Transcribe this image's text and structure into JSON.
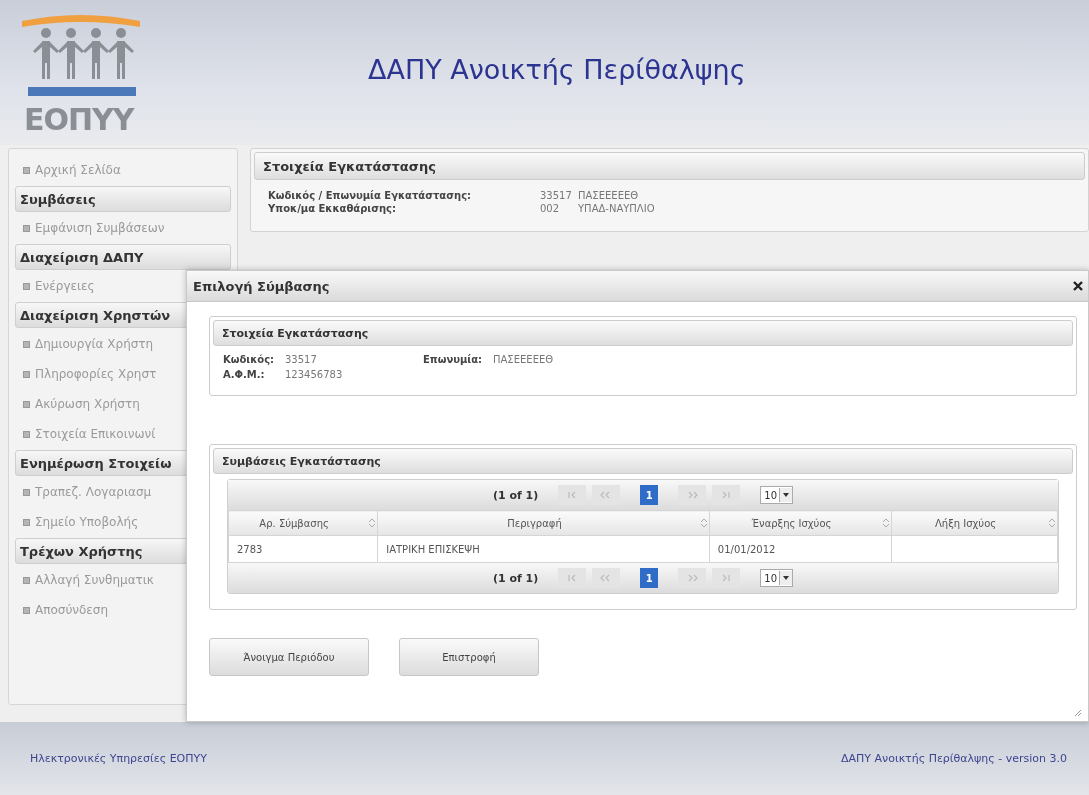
{
  "header": {
    "logo_text": "ΕΟΠΥΥ",
    "title": "ΔΑΠΥ Ανοικτής Περίθαλψης"
  },
  "sidebar": {
    "items": [
      {
        "kind": "link",
        "label": "Αρχική Σελίδα"
      },
      {
        "kind": "section",
        "label": "Συμβάσεις"
      },
      {
        "kind": "link",
        "label": "Εμφάνιση Συμβάσεων"
      },
      {
        "kind": "section",
        "label": "Διαχείριση ΔΑΠΥ"
      },
      {
        "kind": "link",
        "label": "Ενέργειες"
      },
      {
        "kind": "section",
        "label": "Διαχείριση Χρηστών"
      },
      {
        "kind": "link",
        "label": "Δημιουργία Χρήστη"
      },
      {
        "kind": "link",
        "label": "Πληροφορίες Χρηστ"
      },
      {
        "kind": "link",
        "label": "Ακύρωση Χρήστη"
      },
      {
        "kind": "link",
        "label": "Στοιχεία Επικοινωνί"
      },
      {
        "kind": "section",
        "label": "Ενημέρωση Στοιχείω"
      },
      {
        "kind": "link",
        "label": "Τραπεζ. Λογαριασμ"
      },
      {
        "kind": "link",
        "label": "Σημείο Υποβολής"
      },
      {
        "kind": "section",
        "label": "Τρέχων Χρήστης"
      },
      {
        "kind": "link",
        "label": "Αλλαγή Συνθηματικ"
      },
      {
        "kind": "link",
        "label": "Αποσύνδεση"
      }
    ]
  },
  "facility_panel": {
    "title": "Στοιχεία Εγκατάστασης",
    "rows": [
      {
        "label": "Κωδικός / Επωνυμία Εγκατάστασης:",
        "code": "33517",
        "name": "ΠΑΣΕΕΕΕΕΘ"
      },
      {
        "label": "Υποκ/μα Εκκαθάρισης:",
        "code": "002",
        "name": "ΥΠΑΔ-ΝΑΥΠΛΙΟ"
      }
    ]
  },
  "dialog": {
    "title": "Επιλογή Σύμβασης",
    "details": {
      "title": "Στοιχεία Εγκατάστασης",
      "fields": [
        {
          "label": "Κωδικός:",
          "value": "33517"
        },
        {
          "label": "Επωνυμία:",
          "value": "ΠΑΣΕΕΕΕΕΘ"
        },
        {
          "label": "Α.Φ.Μ.:",
          "value": "123456783"
        }
      ]
    },
    "contracts": {
      "title": "Συμβάσεις Εγκατάστασης",
      "paginators": [
        {
          "summary": "(1 of 1)",
          "pages": [
            {
              "label": "1",
              "selected": true
            }
          ],
          "page_size": "10"
        },
        {
          "summary": "(1 of 1)",
          "pages": [
            {
              "label": "1",
              "selected": true
            }
          ],
          "page_size": "10"
        }
      ],
      "columns": [
        "Αρ. Σύμβασης",
        "Περιγραφή",
        "Έναρξης Ισχύος",
        "Λήξη Ισχύος"
      ],
      "rows": [
        {
          "cells": [
            "2783",
            "ΙΑΤΡΙΚΗ ΕΠΙΣΚΕΨΗ",
            "01/01/2012"
          ]
        }
      ]
    },
    "buttons": [
      "Άνοιγμα Περιόδου",
      "Επιστροφή"
    ]
  },
  "footer": {
    "left": "Ηλεκτρονικές Υπηρεσίες ΕΟΠΥΥ",
    "right": "ΔΑΠΥ Ανοικτής Περίθαλψης - version 3.0"
  }
}
